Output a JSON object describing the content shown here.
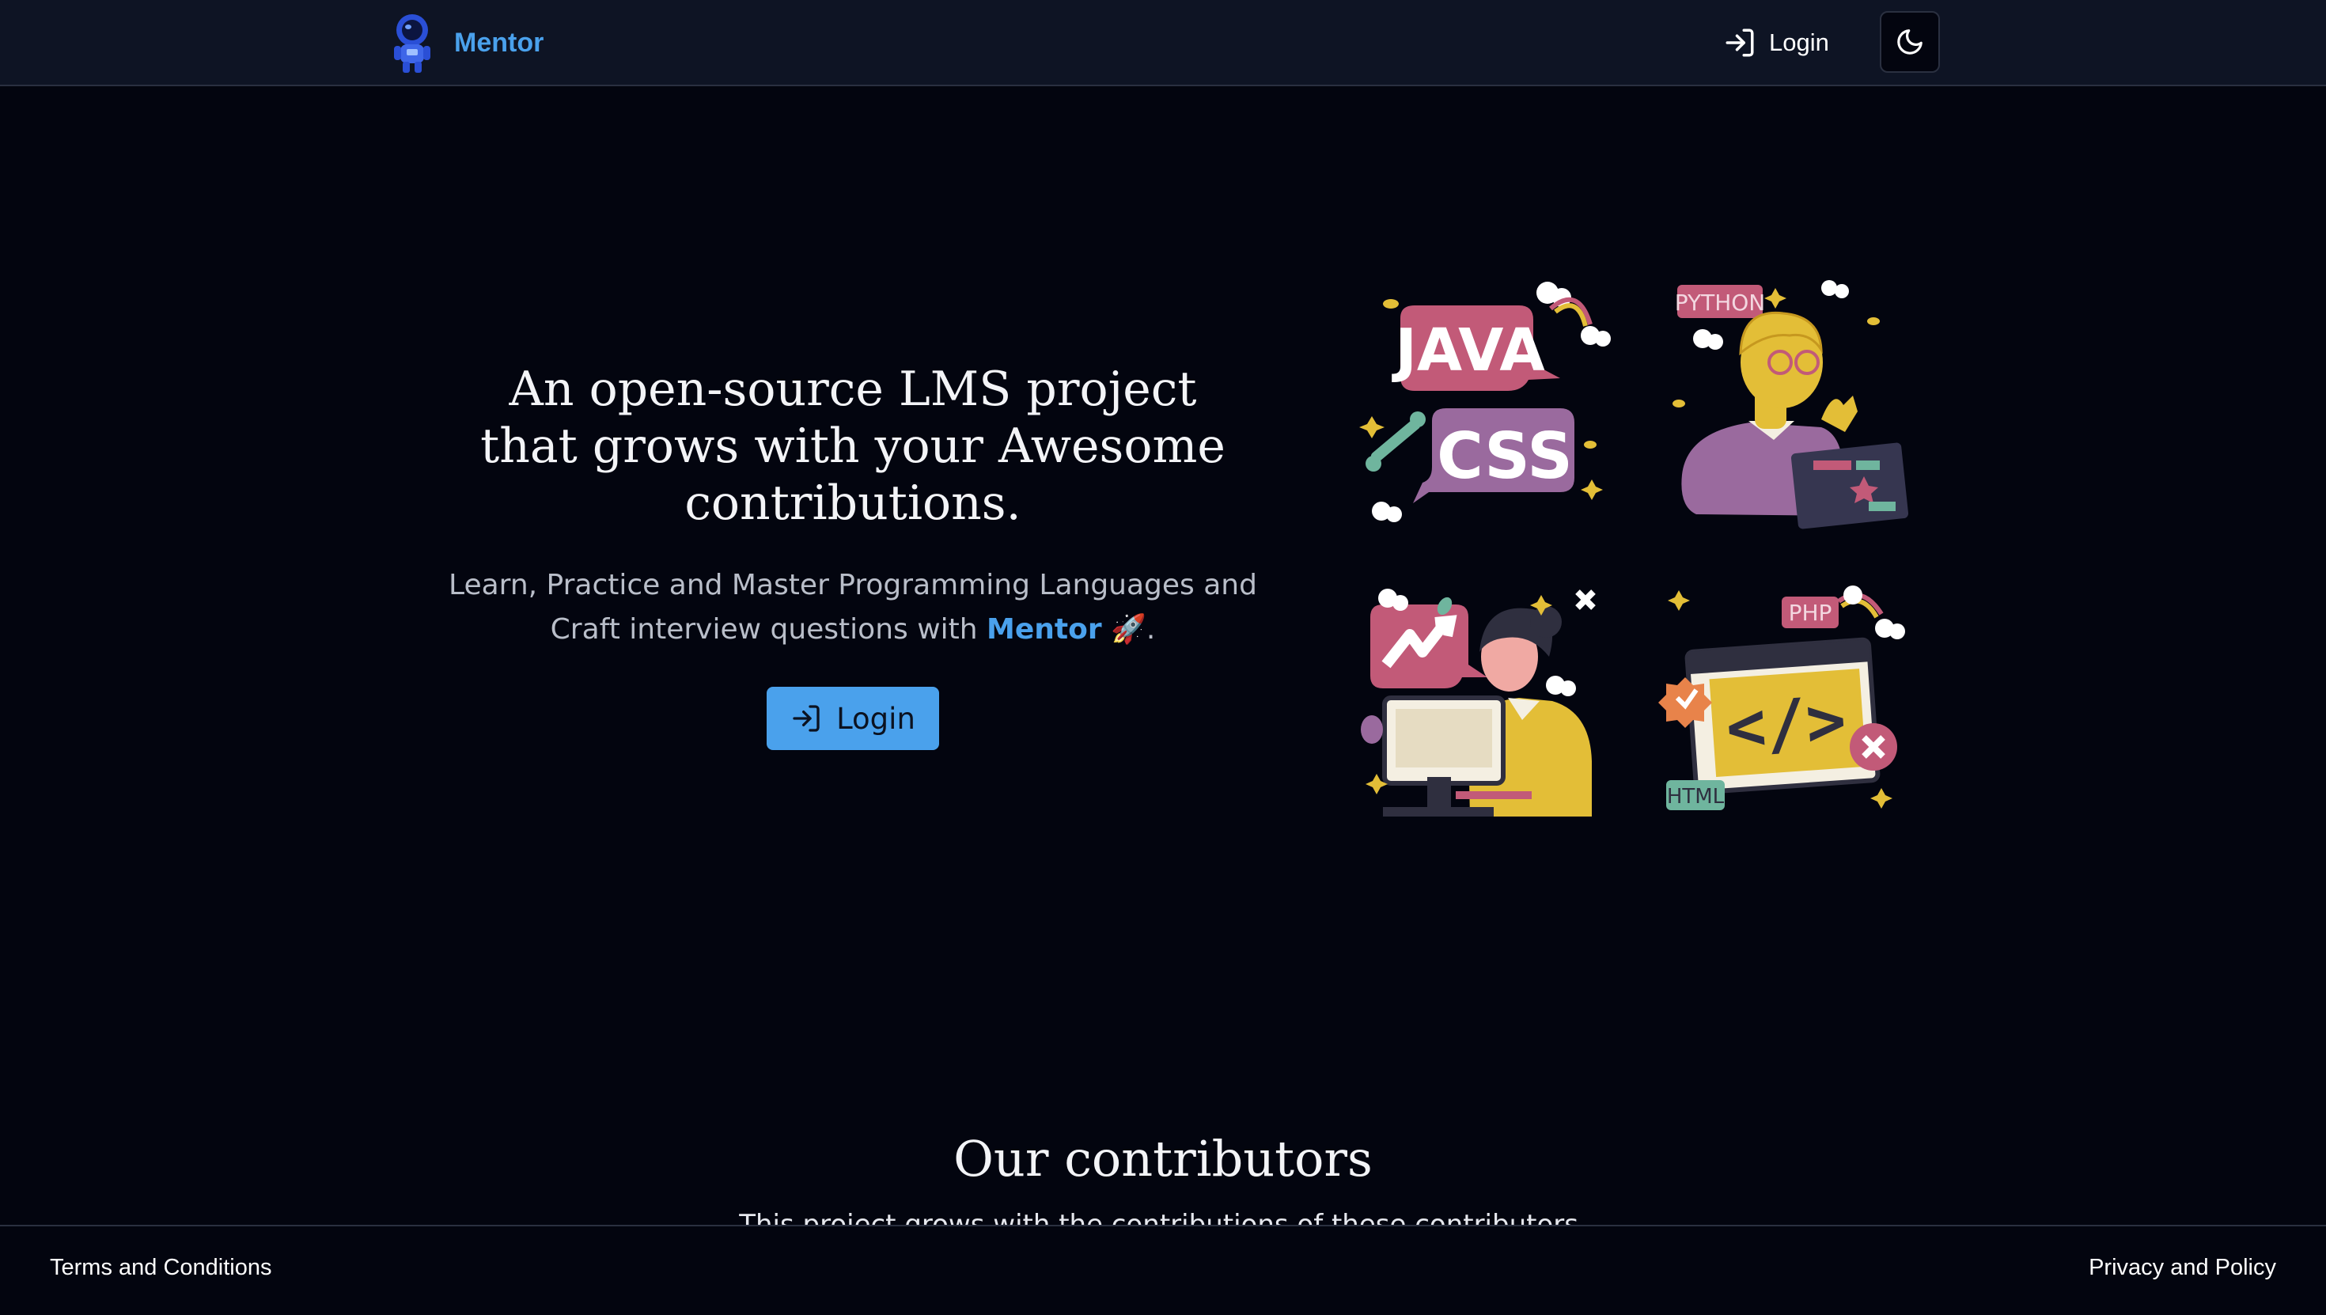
{
  "header": {
    "brand": "Mentor",
    "login_label": "Login",
    "icons": {
      "logo": "astronaut-logo",
      "login": "login-arrow-icon",
      "theme": "moon-icon"
    }
  },
  "hero": {
    "title": "An open-source LMS project that grows with your Awesome contributions.",
    "subtitle_before": "Learn, Practice and Master Programming Languages and Craft interview questions with ",
    "subtitle_brand": "Mentor",
    "subtitle_emoji": "🚀",
    "subtitle_after": ".",
    "cta_label": "Login"
  },
  "illustrations": [
    {
      "name": "java-css-illustration",
      "labels": [
        "JAVA",
        "CSS"
      ]
    },
    {
      "name": "python-developer-illustration",
      "labels": [
        "PYTHON"
      ]
    },
    {
      "name": "developer-at-computer-illustration",
      "labels": []
    },
    {
      "name": "code-window-illustration",
      "labels": [
        "PHP",
        "HTML",
        "</>"
      ]
    }
  ],
  "contributors": {
    "title": "Our contributors",
    "subtitle": "This project grows with the contributions of these contributors."
  },
  "footer": {
    "terms": "Terms and Conditions",
    "privacy": "Privacy and Policy"
  },
  "colors": {
    "accent": "#4aa1ec",
    "background": "#03050f",
    "header": "#0e1424",
    "pink": "#c25a78",
    "purple": "#9a6a9e",
    "yellow": "#e3be37"
  }
}
